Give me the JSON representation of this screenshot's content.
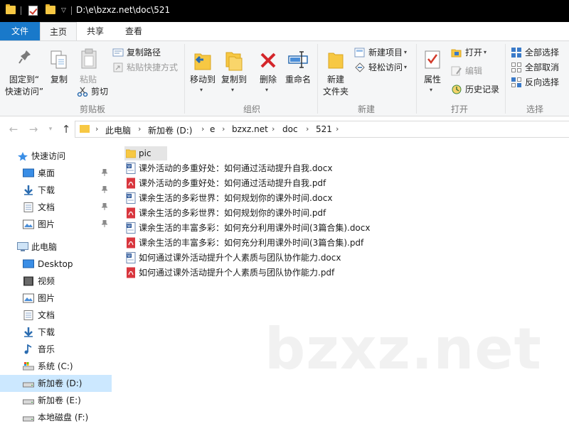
{
  "window": {
    "title": "D:\\e\\bzxz.net\\doc\\521"
  },
  "tabs": {
    "file": "文件",
    "home": "主页",
    "share": "共享",
    "view": "查看"
  },
  "ribbon": {
    "clipboard": {
      "label": "剪贴板",
      "pin_quick_access": "固定到“快速访问”",
      "copy": "复制",
      "paste": "粘贴",
      "copy_path": "复制路径",
      "paste_shortcut": "粘贴快捷方式",
      "cut": "剪切"
    },
    "organize": {
      "label": "组织",
      "move_to": "移动到",
      "copy_to": "复制到",
      "delete": "删除",
      "rename": "重命名"
    },
    "new": {
      "label": "新建",
      "new_folder": "新建\n文件夹",
      "new_item": "新建项目",
      "easy_access": "轻松访问"
    },
    "open": {
      "label": "打开",
      "properties": "属性",
      "open": "打开",
      "edit": "编辑",
      "history": "历史记录"
    },
    "select": {
      "label": "选择",
      "select_all": "全部选择",
      "select_none": "全部取消",
      "invert": "反向选择"
    }
  },
  "address": {
    "crumbs": [
      "此电脑",
      "新加卷 (D:)",
      "e",
      "bzxz.net",
      "doc",
      "521"
    ]
  },
  "nav": {
    "quick_access": "快速访问",
    "qa_items": [
      "桌面",
      "下载",
      "文档",
      "图片"
    ],
    "this_pc": "此电脑",
    "pc_items": [
      "Desktop",
      "视频",
      "图片",
      "文档",
      "下载",
      "音乐",
      "系统 (C:)",
      "新加卷 (D:)",
      "新加卷 (E:)",
      "本地磁盘 (F:)"
    ]
  },
  "files": [
    {
      "name": "pic",
      "type": "folder"
    },
    {
      "name": "课外活动的多重好处：如何通过活动提升自我.docx",
      "type": "docx"
    },
    {
      "name": "课外活动的多重好处：如何通过活动提升自我.pdf",
      "type": "pdf"
    },
    {
      "name": "课余生活的多彩世界：如何规划你的课外时间.docx",
      "type": "docx"
    },
    {
      "name": "课余生活的多彩世界：如何规划你的课外时间.pdf",
      "type": "pdf"
    },
    {
      "name": "课余生活的丰富多彩：如何充分利用课外时间(3篇合集).docx",
      "type": "docx"
    },
    {
      "name": "课余生活的丰富多彩：如何充分利用课外时间(3篇合集).pdf",
      "type": "pdf"
    },
    {
      "name": "如何通过课外活动提升个人素质与团队协作能力.docx",
      "type": "docx"
    },
    {
      "name": "如何通过课外活动提升个人素质与团队协作能力.pdf",
      "type": "pdf"
    }
  ],
  "watermark": "bzxz.net",
  "colors": {
    "accent": "#1979ca",
    "folder": "#f7c843",
    "pdf": "#d9363e",
    "docx": "#2b579a",
    "selected": "#cce8ff"
  }
}
